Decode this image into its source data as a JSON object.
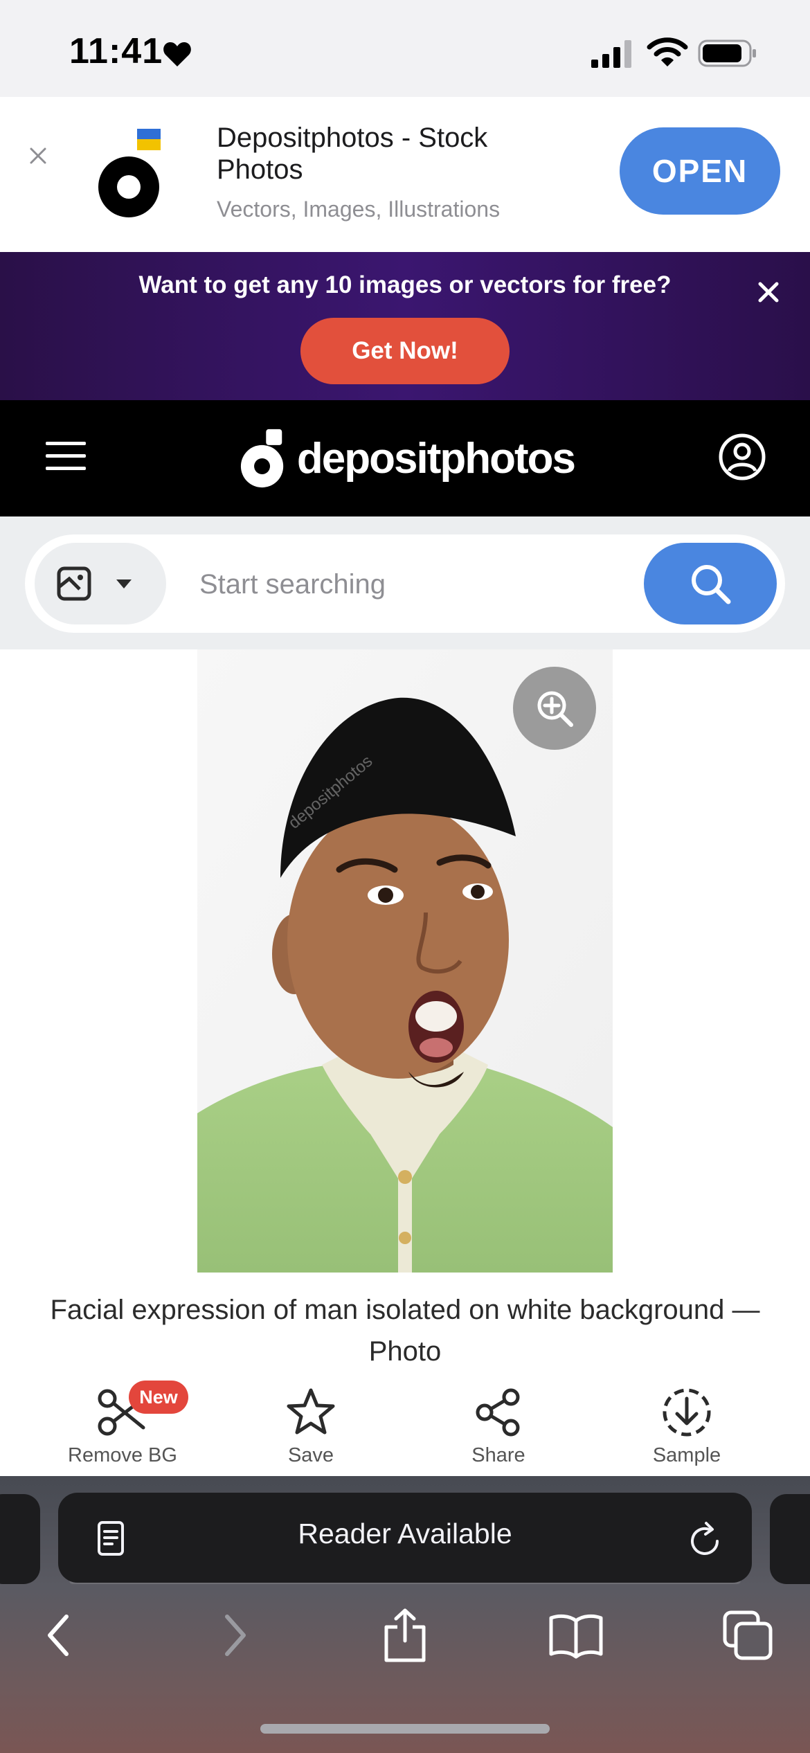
{
  "status_bar": {
    "time": "11:41"
  },
  "app_banner": {
    "title": "Depositphotos - Stock Photos",
    "subtitle": "Vectors, Images, Illustrations",
    "open_label": "OPEN"
  },
  "promo": {
    "text": "Want to get any 10 images or vectors for free?",
    "cta_label": "Get Now!"
  },
  "header": {
    "logo_text": "depositphotos"
  },
  "search": {
    "placeholder": "Start searching",
    "value": ""
  },
  "photo": {
    "caption": "Facial expression of man isolated on white background — Photo",
    "watermark": "depositphotos"
  },
  "actions": [
    {
      "label": "Remove BG",
      "badge": "New",
      "icon": "scissors-icon"
    },
    {
      "label": "Save",
      "icon": "star-icon"
    },
    {
      "label": "Share",
      "icon": "share-icon"
    },
    {
      "label": "Sample",
      "icon": "download-icon"
    }
  ],
  "browser": {
    "address_label": "Reader Available",
    "toolbar": [
      "back-icon",
      "forward-icon",
      "share-icon",
      "bookmarks-icon",
      "tabs-icon"
    ]
  },
  "colors": {
    "accent_blue": "#4a86e0",
    "promo_red": "#e2503c",
    "badge_red": "#e3463c",
    "promo_purple": "#3b1670",
    "header_black": "#000000"
  }
}
